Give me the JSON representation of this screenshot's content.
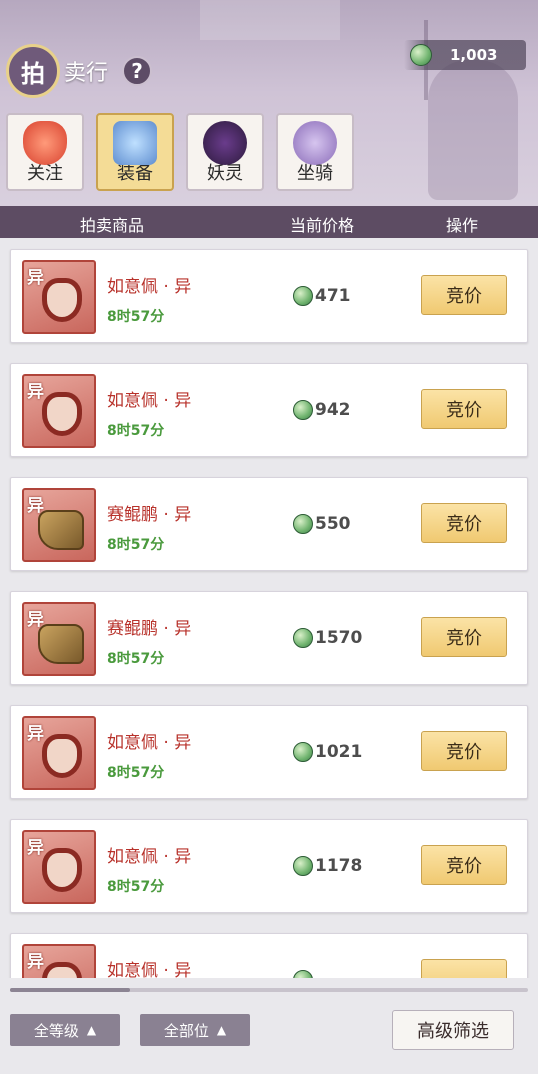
{
  "header": {
    "title_badge": "拍",
    "title_rest": "卖行",
    "help_icon": "?",
    "currency_icon": "jade-coin-icon",
    "currency_amount": "1,003"
  },
  "tabs": [
    {
      "label": "关注",
      "icon": "heart-icon",
      "active": false
    },
    {
      "label": "装备",
      "icon": "armor-icon",
      "active": true
    },
    {
      "label": "妖灵",
      "icon": "spirit-icon",
      "active": false
    },
    {
      "label": "坐骑",
      "icon": "mount-icon",
      "active": false
    }
  ],
  "columns": {
    "item": "拍卖商品",
    "price": "当前价格",
    "action": "操作"
  },
  "items": [
    {
      "tag": "异",
      "name": "如意佩 · 异",
      "time": "8时57分",
      "price": "471",
      "button": "竞价",
      "icon": "pendant-icon"
    },
    {
      "tag": "异",
      "name": "如意佩 · 异",
      "time": "8时57分",
      "price": "942",
      "button": "竞价",
      "icon": "pendant-icon"
    },
    {
      "tag": "异",
      "name": "赛鲲鹏 · 异",
      "time": "8时57分",
      "price": "550",
      "button": "竞价",
      "icon": "boots-icon"
    },
    {
      "tag": "异",
      "name": "赛鲲鹏 · 异",
      "time": "8时57分",
      "price": "1570",
      "button": "竞价",
      "icon": "boots-icon"
    },
    {
      "tag": "异",
      "name": "如意佩 · 异",
      "time": "8时57分",
      "price": "1021",
      "button": "竞价",
      "icon": "pendant-icon"
    },
    {
      "tag": "异",
      "name": "如意佩 · 异",
      "time": "8时57分",
      "price": "1178",
      "button": "竞价",
      "icon": "pendant-icon"
    },
    {
      "tag": "异",
      "name": "如意佩 · 异",
      "time": "",
      "price": "",
      "button": "",
      "icon": "pendant-icon"
    }
  ],
  "bottom": {
    "level_filter": "全等级",
    "slot_filter": "全部位",
    "advanced_filter": "高级筛选"
  },
  "colors": {
    "accent_purple": "#5d4c63",
    "bid_button": "#f4d68b",
    "item_name": "#b8322b",
    "time_green": "#4a9a3d"
  }
}
